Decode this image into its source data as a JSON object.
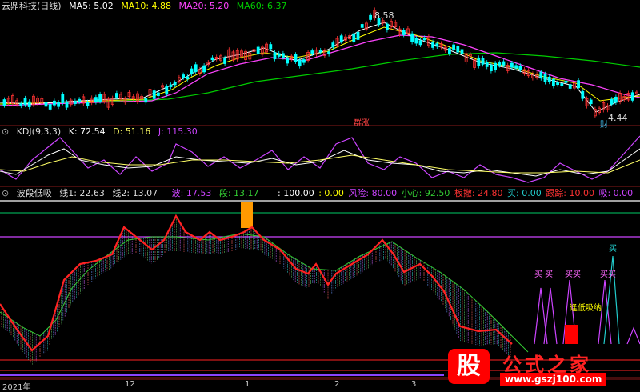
{
  "main": {
    "title": "云鼎科技(日线)",
    "ma5": "MA5: 5.02",
    "ma10": "MA10: 4.88",
    "ma20": "MA20: 5.20",
    "ma60": "MA60: 6.37",
    "high_label": "8.58",
    "low_label": "4.44",
    "low_tag": "财",
    "mark_tag": "群涨"
  },
  "kdj": {
    "title": "KDJ(9,3,3)",
    "k": "K: 72.54",
    "d": "D: 51.16",
    "j": "J: 115.30"
  },
  "ind": {
    "title": "波段低吸",
    "line1": "线1: 22.63",
    "line2": "线2: 13.07",
    "bo": "波: 17.53",
    "duan": "段: 13.17",
    "v100": ": 100.00",
    "v0": ": 0.00",
    "fengxian": "风险: 80.00",
    "xiaoxin": "小心: 92.50",
    "banche": "板撤: 24.80",
    "mai": "买: 0.00",
    "genzong": "跟踪: 10.00",
    "xi": "吸: 0.00",
    "buy1": "买 买",
    "buy2": "买买",
    "buy3": "买买",
    "buy4": "买",
    "dixi": "逢低吸纳"
  },
  "xaxis": {
    "labels": [
      "2021年",
      "12",
      "1",
      "2",
      "3"
    ]
  },
  "watermark": {
    "logo": "股",
    "name": "公式之家",
    "url": "www.gszj100.com"
  },
  "colors": {
    "ma5": "#ffffff",
    "ma10": "#ffff00",
    "ma20": "#ff44ff",
    "ma60": "#00cc00",
    "up": "#ff3333",
    "down": "#00ffff",
    "bg": "#000000"
  }
}
